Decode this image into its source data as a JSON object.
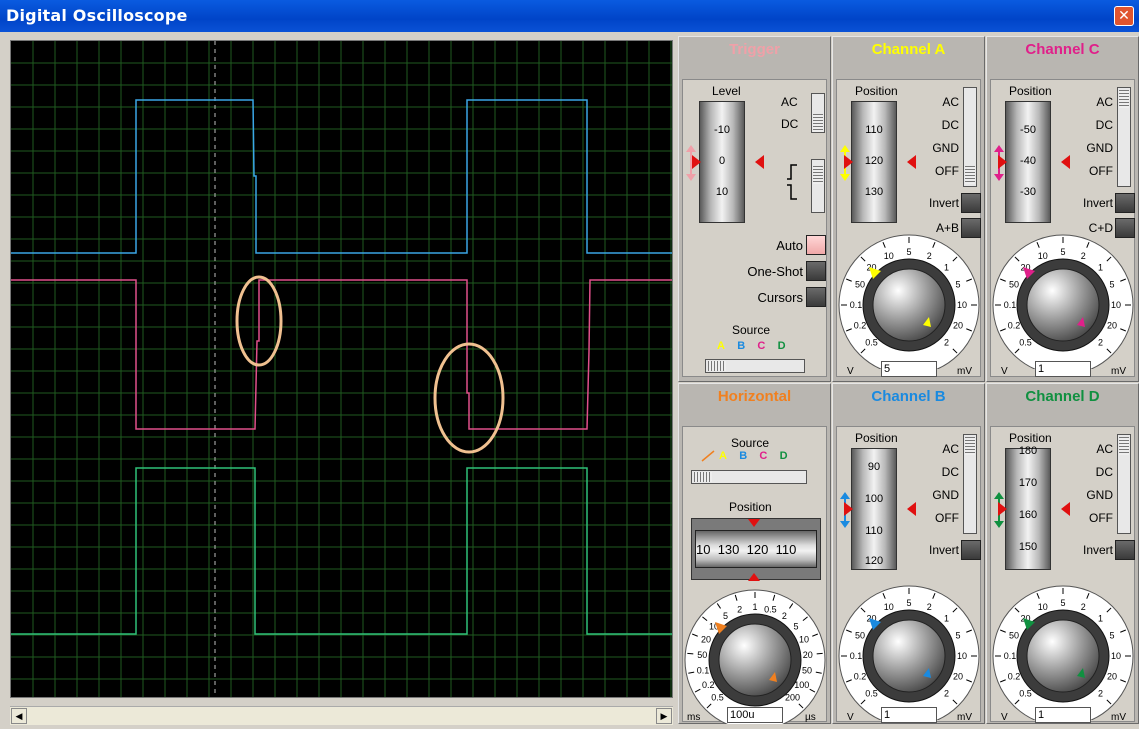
{
  "window": {
    "title": "Digital Oscilloscope"
  },
  "trigger": {
    "title": "Trigger",
    "level_label": "Level",
    "level_ticks": [
      "-10",
      "0",
      "10"
    ],
    "coupling_ac": "AC",
    "coupling_dc": "DC",
    "auto_label": "Auto",
    "oneshot_label": "One-Shot",
    "cursors_label": "Cursors",
    "source_label": "Source",
    "source_letters": [
      "A",
      "B",
      "C",
      "D"
    ]
  },
  "channel_a": {
    "title": "Channel A",
    "position_label": "Position",
    "position_ticks": [
      "110",
      "120",
      "130"
    ],
    "coupling": [
      "AC",
      "DC",
      "GND",
      "OFF"
    ],
    "invert_label": "Invert",
    "combine_label": "A+B",
    "dial_ticks": [
      "0.5",
      "0.2",
      "0.1",
      "50",
      "20",
      "10",
      "5",
      "2",
      "1",
      "5",
      "10",
      "20",
      "2"
    ],
    "unit_left": "V",
    "unit_right": "mV",
    "value": "5"
  },
  "channel_c": {
    "title": "Channel C",
    "position_label": "Position",
    "position_ticks": [
      "-50",
      "-40",
      "-30"
    ],
    "coupling": [
      "AC",
      "DC",
      "GND",
      "OFF"
    ],
    "invert_label": "Invert",
    "combine_label": "C+D",
    "dial_ticks": [
      "0.5",
      "0.2",
      "0.1",
      "50",
      "20",
      "10",
      "5",
      "2",
      "1",
      "5",
      "10",
      "20",
      "2"
    ],
    "unit_left": "V",
    "unit_right": "mV",
    "value": "1"
  },
  "horizontal": {
    "title": "Horizontal",
    "source_label": "Source",
    "source_letters": [
      "A",
      "B",
      "C",
      "D"
    ],
    "position_label": "Position",
    "position_ticks": [
      "10",
      "130",
      "120",
      "110"
    ],
    "dial_ticks": [
      "0.5",
      "0.2",
      "0.1",
      "50",
      "20",
      "10",
      "5",
      "2",
      "1",
      "0.5",
      "2",
      "5",
      "10",
      "20",
      "50",
      "100",
      "200"
    ],
    "unit_left": "ms",
    "unit_right": "µs",
    "value": "100u"
  },
  "channel_b": {
    "title": "Channel B",
    "position_label": "Position",
    "position_ticks": [
      "90",
      "100",
      "110",
      "120"
    ],
    "coupling": [
      "AC",
      "DC",
      "GND",
      "OFF"
    ],
    "invert_label": "Invert",
    "dial_ticks": [
      "0.5",
      "0.2",
      "0.1",
      "50",
      "20",
      "10",
      "5",
      "2",
      "1",
      "5",
      "10",
      "20",
      "2"
    ],
    "unit_left": "V",
    "unit_right": "mV",
    "value": "1"
  },
  "channel_d": {
    "title": "Channel D",
    "position_label": "Position",
    "position_ticks": [
      "180",
      "170",
      "160",
      "150"
    ],
    "coupling": [
      "AC",
      "DC",
      "GND",
      "OFF"
    ],
    "invert_label": "Invert",
    "dial_ticks": [
      "0.5",
      "0.2",
      "0.1",
      "50",
      "20",
      "10",
      "5",
      "2",
      "1",
      "5",
      "10",
      "20",
      "2"
    ],
    "unit_left": "V",
    "unit_right": "mV",
    "value": "1"
  },
  "colors": {
    "trace_a": "#3aa6e6",
    "trace_b": "#e0508a",
    "trace_c": "#2fbf78",
    "highlight_circle": "#f0c090",
    "grid": "#1f5a1f",
    "head_trigger": "#f0a0a8",
    "head_a": "#ffff00",
    "head_c": "#e0208a",
    "head_h": "#f08020",
    "head_b": "#1a8ae0",
    "head_d": "#109040"
  }
}
